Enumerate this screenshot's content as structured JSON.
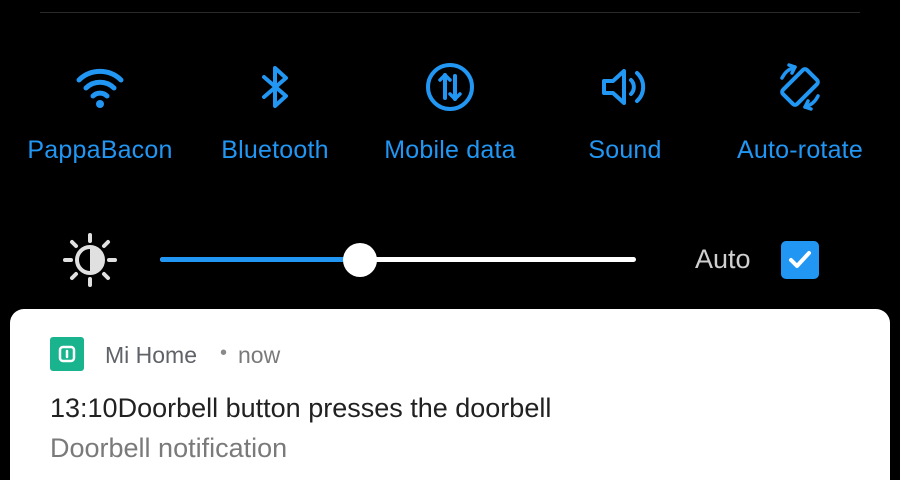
{
  "quick_tiles": [
    {
      "label": "PappaBacon",
      "icon": "wifi-icon"
    },
    {
      "label": "Bluetooth",
      "icon": "bluetooth-icon"
    },
    {
      "label": "Mobile data",
      "icon": "mobile-data-icon"
    },
    {
      "label": "Sound",
      "icon": "volume-icon"
    },
    {
      "label": "Auto-rotate",
      "icon": "auto-rotate-icon"
    }
  ],
  "brightness": {
    "icon": "brightness-icon",
    "level_fraction": 0.42,
    "auto_label": "Auto",
    "auto_checked": true
  },
  "notification": {
    "app_name": "Mi Home",
    "separator": "•",
    "time": "now",
    "title": "13:10Doorbell button presses the doorbell",
    "text": "Doorbell notification"
  },
  "colors": {
    "accent": "#2196f3",
    "background": "#000000",
    "card": "#ffffff",
    "app_icon": "#19b38e"
  }
}
